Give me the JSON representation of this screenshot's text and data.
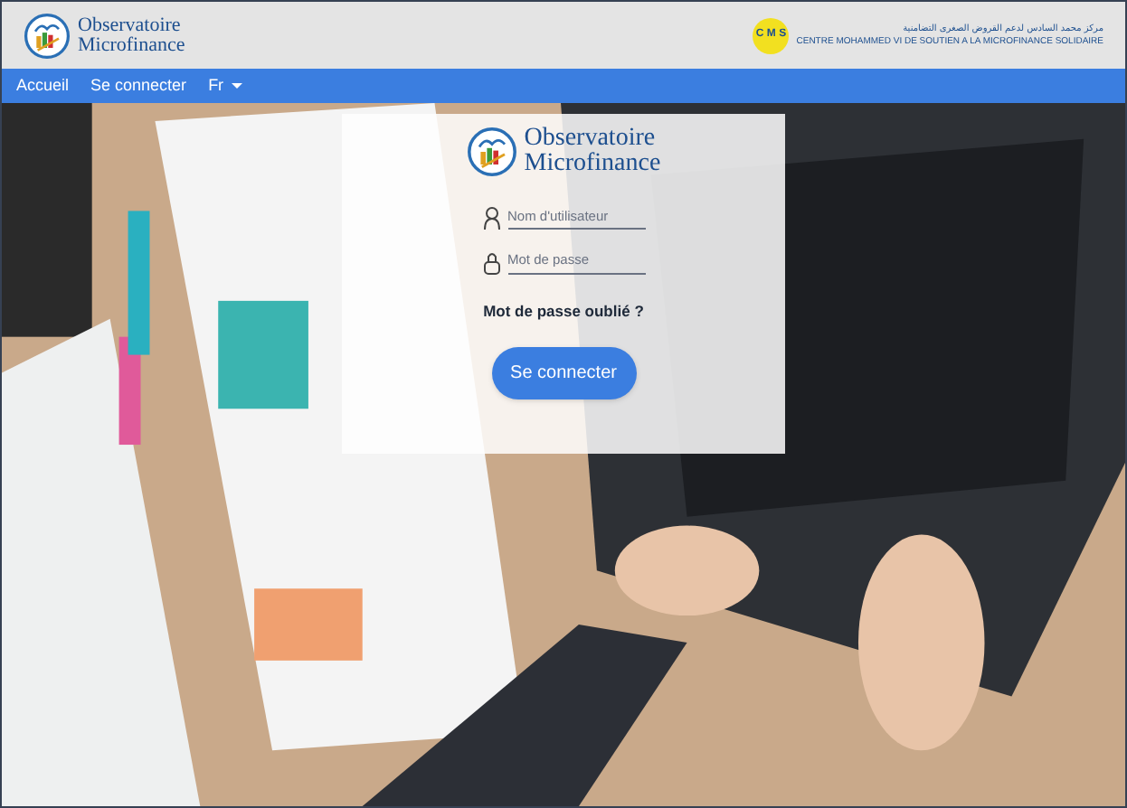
{
  "header": {
    "logo_line_1": "Observatoire",
    "logo_line_2": "Microfinance",
    "partner_badge": "C M S",
    "partner_name_ar": "مركز محمد السادس لدعم القروض الصغرى التضامنية",
    "partner_name_fr": "CENTRE MOHAMMED VI DE SOUTIEN A LA MICROFINANCE SOLIDAIRE"
  },
  "nav": {
    "items": [
      {
        "label": "Accueil",
        "kind": "link"
      },
      {
        "label": "Se connecter",
        "kind": "link"
      },
      {
        "label": "Fr",
        "kind": "dropdown"
      }
    ]
  },
  "login": {
    "logo_line_1": "Observatoire",
    "logo_line_2": "Microfinance",
    "fields": [
      {
        "placeholder": "Nom d'utilisateur",
        "kind": "user"
      },
      {
        "placeholder": "Mot de passe",
        "kind": "password"
      }
    ],
    "forgot_link": "Mot de passe oublié ?",
    "submit": "Se connecter"
  }
}
